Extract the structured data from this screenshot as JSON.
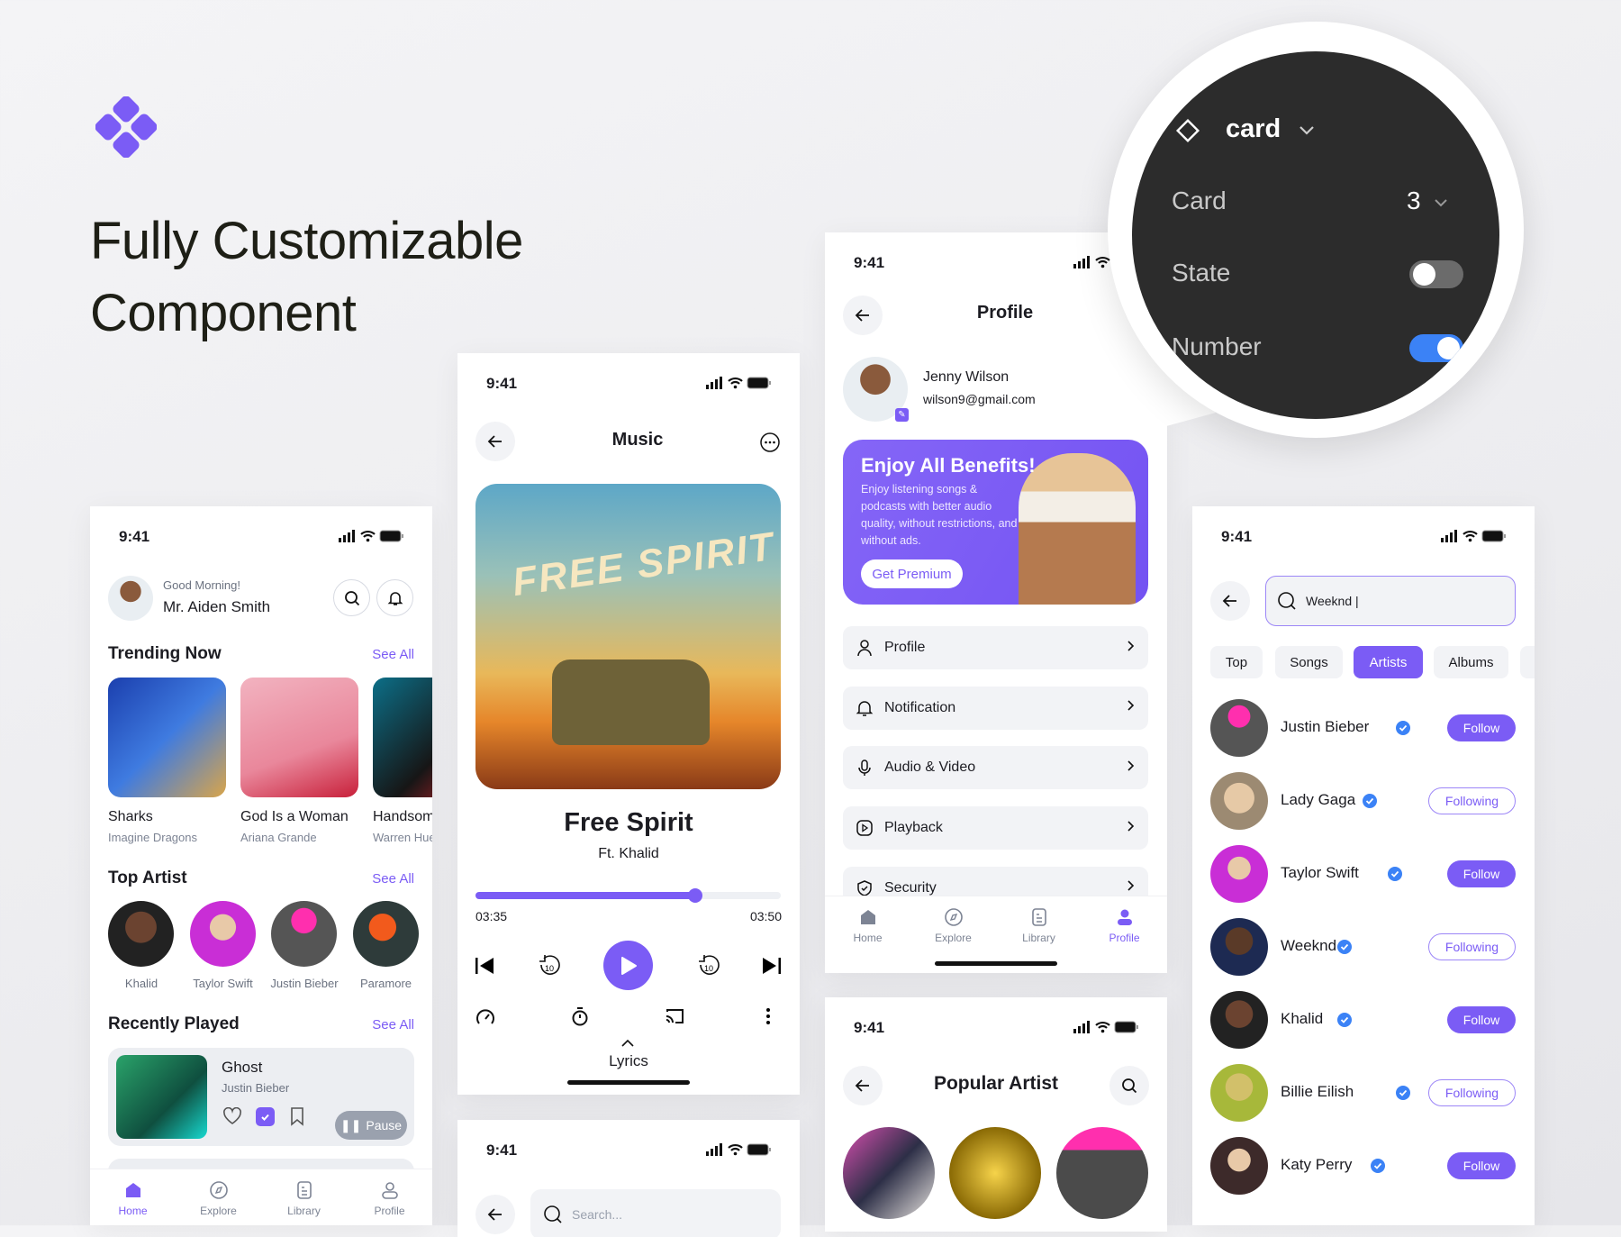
{
  "headline": {
    "line1": "Fully Customizable",
    "line2": "Component"
  },
  "colors": {
    "accent": "#7b5cf5",
    "toggle_on": "#3b82f6",
    "panel": "#2c2c2c"
  },
  "status_time": "9:41",
  "home": {
    "greeting": "Good Morning!",
    "user_name": "Mr. Aiden Smith",
    "trending_title": "Trending Now",
    "see_all": "See All",
    "trending": [
      {
        "title": "Sharks",
        "artist": "Imagine Dragons"
      },
      {
        "title": "God Is a Woman",
        "artist": "Ariana Grande"
      },
      {
        "title": "Handsome",
        "artist": "Warren Hue"
      }
    ],
    "top_artist_title": "Top Artist",
    "top_artists": [
      "Khalid",
      "Taylor Swift",
      "Justin Bieber",
      "Paramore"
    ],
    "recent_title": "Recently Played",
    "recent": {
      "title": "Ghost",
      "artist": "Justin Bieber",
      "pause_label": "Pause"
    },
    "nav": [
      "Home",
      "Explore",
      "Library",
      "Profile"
    ]
  },
  "player": {
    "title": "Music",
    "song": "Free Spirit",
    "featuring": "Ft. Khalid",
    "elapsed": "03:35",
    "total": "03:50",
    "progress": 0.72,
    "lyrics_label": "Lyrics",
    "album_art_text": "FREE SPIRIT"
  },
  "search_small": {
    "placeholder": "Search..."
  },
  "profile": {
    "title": "Profile",
    "name": "Jenny Wilson",
    "email": "wilson9@gmail.com",
    "banner": {
      "title": "Enjoy All Benefits!",
      "body": "Enjoy listening songs & podcasts with better audio quality, without restrictions, and without ads.",
      "button": "Get Premium"
    },
    "menu": [
      {
        "label": "Profile",
        "icon": "user-icon"
      },
      {
        "label": "Notification",
        "icon": "bell-icon"
      },
      {
        "label": "Audio & Video",
        "icon": "microphone-icon"
      },
      {
        "label": "Playback",
        "icon": "play-icon"
      },
      {
        "label": "Security",
        "icon": "shield-icon"
      }
    ],
    "nav": [
      "Home",
      "Explore",
      "Library",
      "Profile"
    ]
  },
  "popular": {
    "title": "Popular Artist"
  },
  "search": {
    "query": "Weeknd |",
    "tabs": [
      "Top",
      "Songs",
      "Artists",
      "Albums"
    ],
    "active_tab": "Artists",
    "results": [
      {
        "name": "Justin Bieber",
        "state": "Follow"
      },
      {
        "name": "Lady Gaga",
        "state": "Following"
      },
      {
        "name": "Taylor Swift",
        "state": "Follow"
      },
      {
        "name": "Weeknd",
        "state": "Following"
      },
      {
        "name": "Khalid",
        "state": "Follow"
      },
      {
        "name": "Billie Eilish",
        "state": "Following"
      },
      {
        "name": "Katy Perry",
        "state": "Follow"
      }
    ]
  },
  "props_panel": {
    "component": "card",
    "rows": [
      {
        "label": "Card",
        "value": "3"
      },
      {
        "label": "State",
        "toggle": false
      },
      {
        "label": "Number",
        "toggle": true
      }
    ]
  }
}
